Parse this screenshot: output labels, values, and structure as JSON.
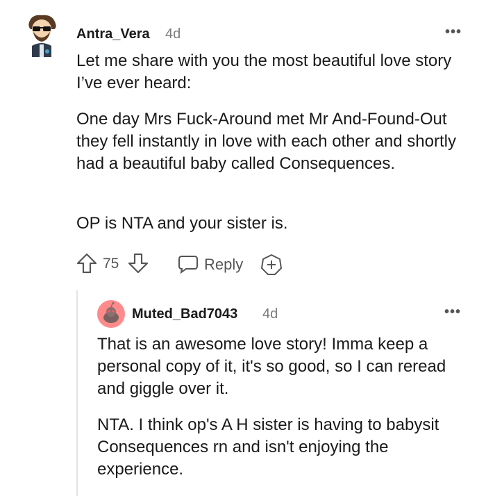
{
  "comment": {
    "author": "Antra_Vera",
    "age": "4d",
    "more_label": "•••",
    "paragraphs": [
      "Let me share with you the most beautiful love story I’ve ever heard:",
      "One day Mrs Fuck-Around met Mr And-Found-Out they fell instantly in love with each other and shortly had a beautiful baby called Consequences.",
      "OP is NTA and your sister is."
    ],
    "vote_count": "75",
    "reply_label": "Reply"
  },
  "reply": {
    "author": "Muted_Bad7043",
    "age": "4d",
    "more_label": "•••",
    "paragraphs": [
      "That is an awesome love story! Imma keep a personal copy of it, it's so good, so I can reread and giggle over it.",
      "NTA. I think op's A H sister is having to babysit Consequences rn and isn't enjoying the experience."
    ]
  },
  "icons": {
    "upvote": "arrow-up-icon",
    "downvote": "arrow-down-icon",
    "reply": "speech-bubble-icon",
    "award": "award-plus-icon",
    "more": "more-dots-icon"
  },
  "colors": {
    "text": "#1a1a1b",
    "meta": "#7c7c7c",
    "icon": "#555555",
    "reply_avatar_bg": "#ff585b"
  }
}
